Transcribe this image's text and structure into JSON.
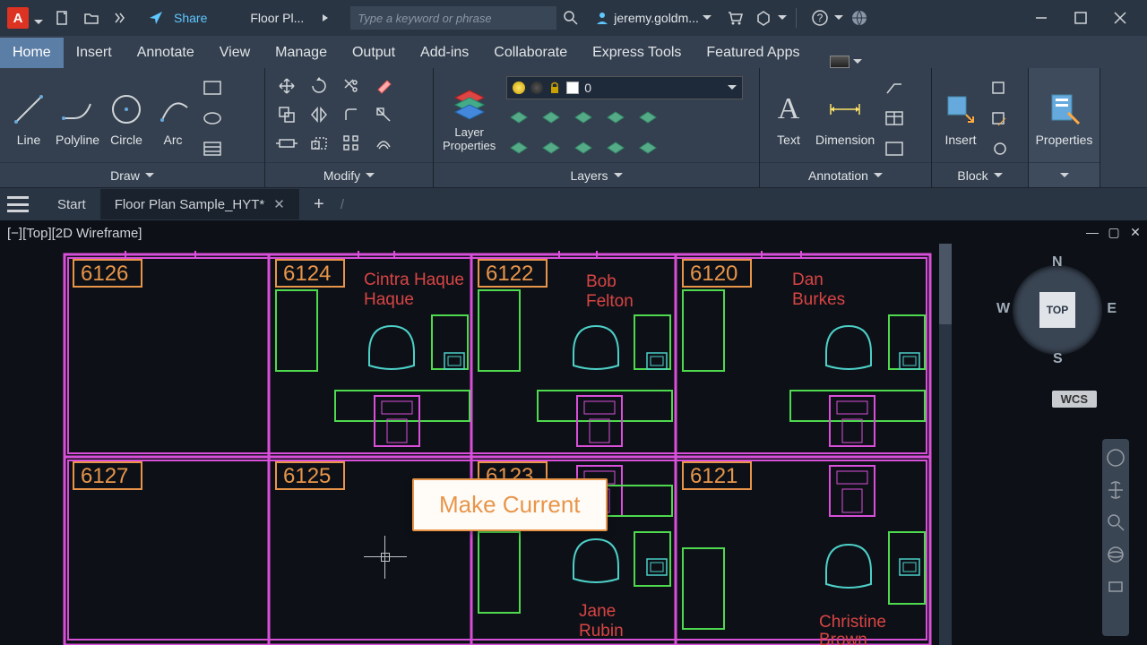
{
  "titlebar": {
    "app_letter": "A",
    "share": "Share",
    "doc_title": "Floor Pl...",
    "search_placeholder": "Type a keyword or phrase",
    "user": "jeremy.goldm..."
  },
  "menu": {
    "tabs": [
      "Home",
      "Insert",
      "Annotate",
      "View",
      "Manage",
      "Output",
      "Add-ins",
      "Collaborate",
      "Express Tools",
      "Featured Apps"
    ]
  },
  "ribbon": {
    "draw": {
      "line": "Line",
      "polyline": "Polyline",
      "circle": "Circle",
      "arc": "Arc",
      "label": "Draw"
    },
    "modify": {
      "label": "Modify"
    },
    "layers": {
      "layer_props": "Layer\nProperties",
      "current": "0",
      "label": "Layers"
    },
    "annot": {
      "text": "Text",
      "dimension": "Dimension",
      "label": "Annotation"
    },
    "block": {
      "insert": "Insert",
      "label": "Block"
    },
    "props": {
      "label": "Properties"
    }
  },
  "doctabs": {
    "start": "Start",
    "file": "Floor Plan Sample_HYT*"
  },
  "viewport": {
    "label": "[−][Top][2D Wireframe]",
    "cube_top": "TOP",
    "n": "N",
    "s": "S",
    "e": "E",
    "w": "W",
    "wcs": "WCS"
  },
  "rooms": {
    "r6126": "6126",
    "r6124": "6124",
    "r6122": "6122",
    "r6120": "6120",
    "r6127": "6127",
    "r6125": "6125",
    "r6123": "6123",
    "r6121": "6121",
    "p_cintra": "Cintra\nHaque",
    "p_bob": "Bob\nFelton",
    "p_dan": "Dan\nBurkes",
    "p_jane": "Jane\nRubin",
    "p_christine": "Christine\nBrown"
  },
  "tooltip": {
    "text": "Make Current"
  }
}
